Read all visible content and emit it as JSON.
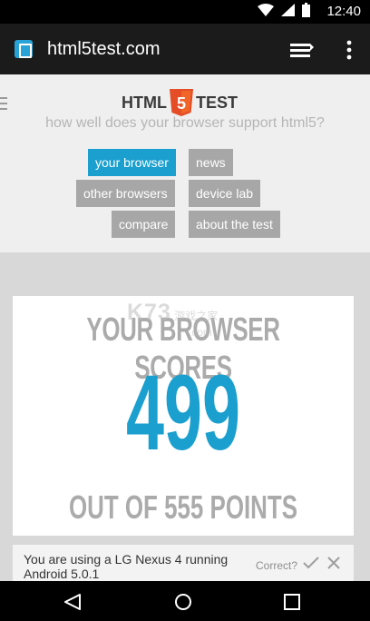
{
  "status_bar": {
    "time": "12:40",
    "icons": [
      "wifi-icon",
      "signal-icon",
      "battery-icon"
    ]
  },
  "app_bar": {
    "title": "html5test.com",
    "icons": [
      "site-icon",
      "tabs-icon",
      "overflow-menu-icon"
    ]
  },
  "header": {
    "logo_left": "HTML",
    "logo_shield": "5",
    "logo_right": "TEST",
    "tagline": "how well does your browser support html5?"
  },
  "nav": {
    "items": [
      {
        "label": "your browser",
        "active": true
      },
      {
        "label": "news",
        "active": false
      },
      {
        "label": "other browsers",
        "active": false
      },
      {
        "label": "device lab",
        "active": false
      },
      {
        "label": "compare",
        "active": false
      },
      {
        "label": "about the test",
        "active": false
      }
    ]
  },
  "score": {
    "line1": "YOUR BROWSER SCORES",
    "value": "499",
    "line3": "OUT OF 555 POINTS"
  },
  "watermark": {
    "line1": "K73",
    "line2": "游戏之家",
    "line3": ".com"
  },
  "device": {
    "text": "You are using a LG Nexus 4 running Android 5.0.1",
    "correct_label": "Correct?"
  },
  "colors": {
    "accent": "#1a9fce",
    "logo_orange": "#e44d26",
    "button_gray": "#a7a7a7",
    "score_gray": "#ababab"
  }
}
